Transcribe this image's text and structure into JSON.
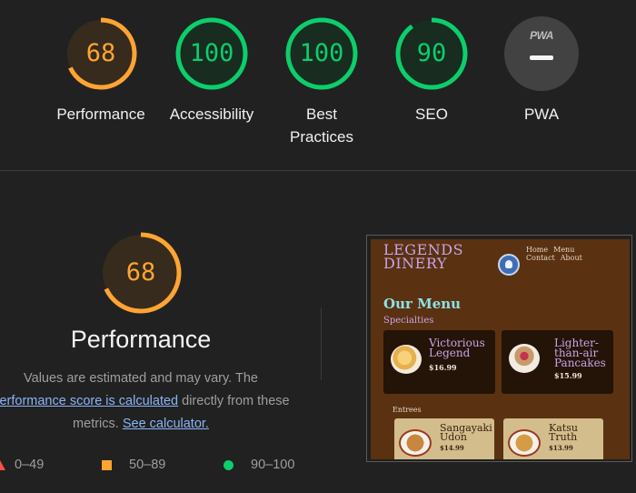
{
  "gauges": [
    {
      "score": "68",
      "label": "Performance",
      "color": "#ffa433",
      "fraction": 0.68
    },
    {
      "score": "100",
      "label": "Accessibility",
      "color": "#0cce6b",
      "fraction": 1.0
    },
    {
      "score": "100",
      "label": "Best Practices",
      "color": "#0cce6b",
      "fraction": 1.0
    },
    {
      "score": "90",
      "label": "SEO",
      "color": "#0cce6b",
      "fraction": 0.9
    }
  ],
  "pwa": {
    "badge": "PWA",
    "label": "PWA"
  },
  "detail": {
    "score": "68",
    "fraction": 0.68,
    "title": "Performance",
    "desc_1": "Values are estimated and may vary. The",
    "desc_link": "performance score is calculated",
    "desc_2": "directly from these",
    "desc_3": "metrics.",
    "calc_link": "See calculator."
  },
  "legend": {
    "fail": "0–49",
    "average": "50–89",
    "pass": "90–100"
  },
  "colors": {
    "fail": "#ff4e42",
    "average": "#ffa433",
    "pass": "#0cce6b",
    "accent_link": "#8ab4f8"
  },
  "screenshot": {
    "brand_1": "LEGENDS",
    "brand_2": "DINERY",
    "nav": [
      "Home",
      "Menu",
      "Contact",
      "About"
    ],
    "title": "Our Menu",
    "section": "Specialties",
    "specialties": [
      {
        "name_1": "Victorious",
        "name_2": "Legend",
        "name_3": "",
        "price": "$16.99"
      },
      {
        "name_1": "Lighter-",
        "name_2": "than-air",
        "name_3": "Pancakes",
        "price": "$15.99"
      }
    ],
    "entrees_label": "Entrees",
    "entrees": [
      {
        "name_1": "Sangayaki",
        "name_2": "Udon",
        "price": "$14.99"
      },
      {
        "name_1": "Katsu",
        "name_2": "Truth",
        "price": "$13.99"
      }
    ]
  }
}
